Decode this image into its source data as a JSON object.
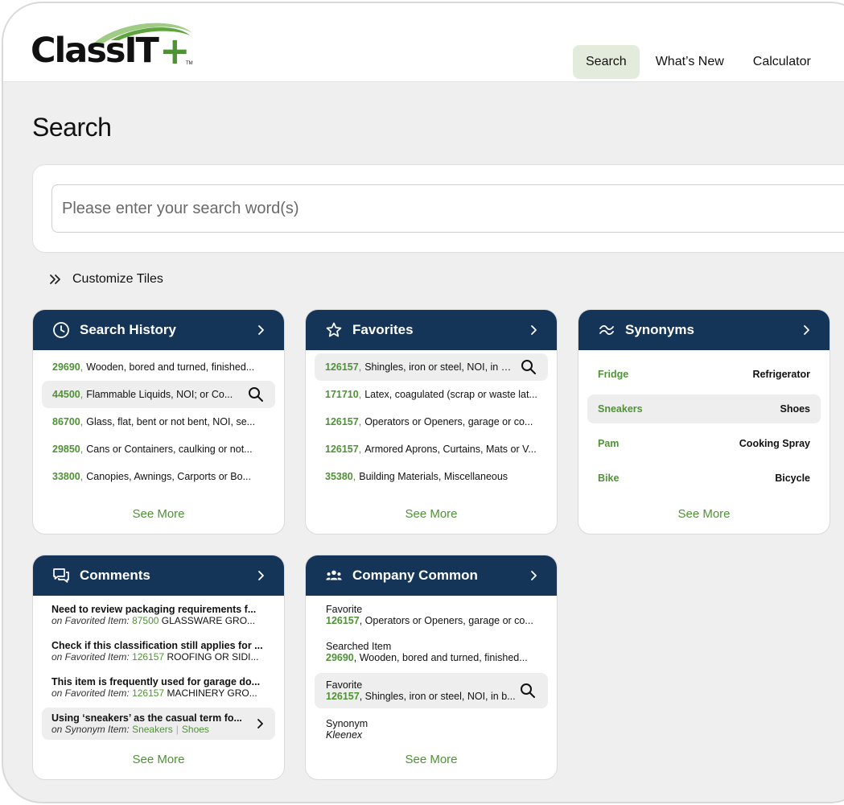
{
  "header": {
    "logo_text": "ClassIT",
    "logo_plus": "+",
    "logo_tm": "TM",
    "nav": [
      {
        "label": "Search"
      },
      {
        "label": "What’s New"
      },
      {
        "label": "Calculator"
      }
    ]
  },
  "page": {
    "title": "Search",
    "search_placeholder": "Please enter your search word(s)",
    "customize_label": "Customize Tiles"
  },
  "tiles": {
    "search_history": {
      "title": "Search History",
      "see_more": "See More",
      "items": [
        {
          "code": "29690",
          "desc": "Wooden, bored and turned, finished..."
        },
        {
          "code": "44500",
          "desc": "Flammable Liquids, NOI; or Co..."
        },
        {
          "code": "86700",
          "desc": "Glass, flat, bent or not bent, NOI, se..."
        },
        {
          "code": "29850",
          "desc": "Cans or Containers, caulking or not..."
        },
        {
          "code": "33800",
          "desc": "Canopies, Awnings, Carports or Bo..."
        }
      ]
    },
    "favorites": {
      "title": "Favorites",
      "see_more": "See More",
      "items": [
        {
          "code": "126157",
          "desc": "Shingles, iron or steel, NOI, in bo..."
        },
        {
          "code": "171710",
          "desc": "Latex, coagulated (scrap or waste lat..."
        },
        {
          "code": "126157",
          "desc": "Operators or Openers, garage or co..."
        },
        {
          "code": "126157",
          "desc": "Armored Aprons, Curtains, Mats or V..."
        },
        {
          "code": "35380",
          "desc": "Building Materials, Miscellaneous"
        }
      ]
    },
    "synonyms": {
      "title": "Synonyms",
      "see_more": "See More",
      "items": [
        {
          "term": "Fridge",
          "synonym": "Refrigerator"
        },
        {
          "term": "Sneakers",
          "synonym": "Shoes"
        },
        {
          "term": "Pam",
          "synonym": "Cooking Spray"
        },
        {
          "term": "Bike",
          "synonym": "Bicycle"
        }
      ]
    },
    "comments": {
      "title": "Comments",
      "see_more": "See More",
      "items": [
        {
          "text": "Need to review packaging requirements f...",
          "on_label": "on Favorited Item:",
          "code": "87500",
          "rest": "GLASSWARE GRO..."
        },
        {
          "text": "Check if this classification still applies for ...",
          "on_label": "on Favorited Item:",
          "code": "126157",
          "rest": "ROOFING OR SIDI..."
        },
        {
          "text": "This item is frequently used for garage do...",
          "on_label": "on Favorited Item:",
          "code": "126157",
          "rest": "MACHINERY GRO..."
        },
        {
          "text": "Using ‘sneakers’ as the casual term fo...",
          "on_label": "on Synonym Item:",
          "code": "Sneakers",
          "sep": "|",
          "rest": "Shoes"
        }
      ]
    },
    "company_common": {
      "title": "Company Common",
      "see_more": "See More",
      "items": [
        {
          "type": "Favorite",
          "code": "126157",
          "desc": "Operators or Openers, garage or co..."
        },
        {
          "type": "Searched Item",
          "code": "29690",
          "desc": "Wooden, bored and turned, finished..."
        },
        {
          "type": "Favorite",
          "code": "126157",
          "desc": "Shingles, iron or steel, NOI, in b..."
        },
        {
          "type": "Synonym",
          "desc": "Kleenex"
        }
      ]
    }
  },
  "colors": {
    "tile_header": "#143557",
    "accent_green": "#4f9236",
    "nav_active_bg": "#e3ecdc",
    "page_bg": "#efefef"
  }
}
